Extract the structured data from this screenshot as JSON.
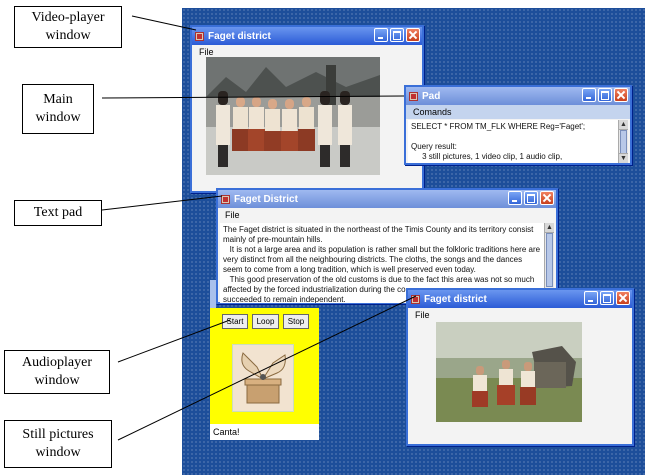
{
  "callouts": {
    "video_player": "Video-player window",
    "main": "Main window",
    "text_pad": "Text pad",
    "audioplayer": "Audioplayer window",
    "still_pictures": "Still pictures window"
  },
  "video_window": {
    "title": "Faget district",
    "menu": [
      "File"
    ]
  },
  "pad_window": {
    "title": "Pad",
    "menu": [
      "Comands"
    ],
    "lines": [
      "SELECT * FROM TM_FLK WHERE Reg='Faget';",
      "",
      "Query result:",
      "     3 still pictures, 1 video clip, 1 audio clip,"
    ]
  },
  "text_window": {
    "title": "Faget District",
    "menu": [
      "File"
    ],
    "paragraphs": [
      "The Faget district is situated in the northeast of the Timis County and its territory consist mainly of pre-mountain hills.",
      "   It is not a large area and its population is rather small but the folkloric traditions here are very distinct from all the neighbouring districts. The cloths, the songs and the dances seem to come from a long tradition, which is well preserved even today.",
      "   This good preservation of the old customs is due to the fact this area was not so much affected by the forced industrialization during the co",
      "succeeded to remain independent."
    ]
  },
  "audio_window": {
    "buttons": [
      "Start",
      "Loop",
      "Stop"
    ],
    "caption": "Canta!"
  },
  "still_window": {
    "title": "Faget district",
    "menu": [
      "File"
    ]
  },
  "colors": {
    "desktop": "#1d4e9a",
    "titlebar": "#2b5bd6",
    "audio_panel": "#ffff00"
  }
}
